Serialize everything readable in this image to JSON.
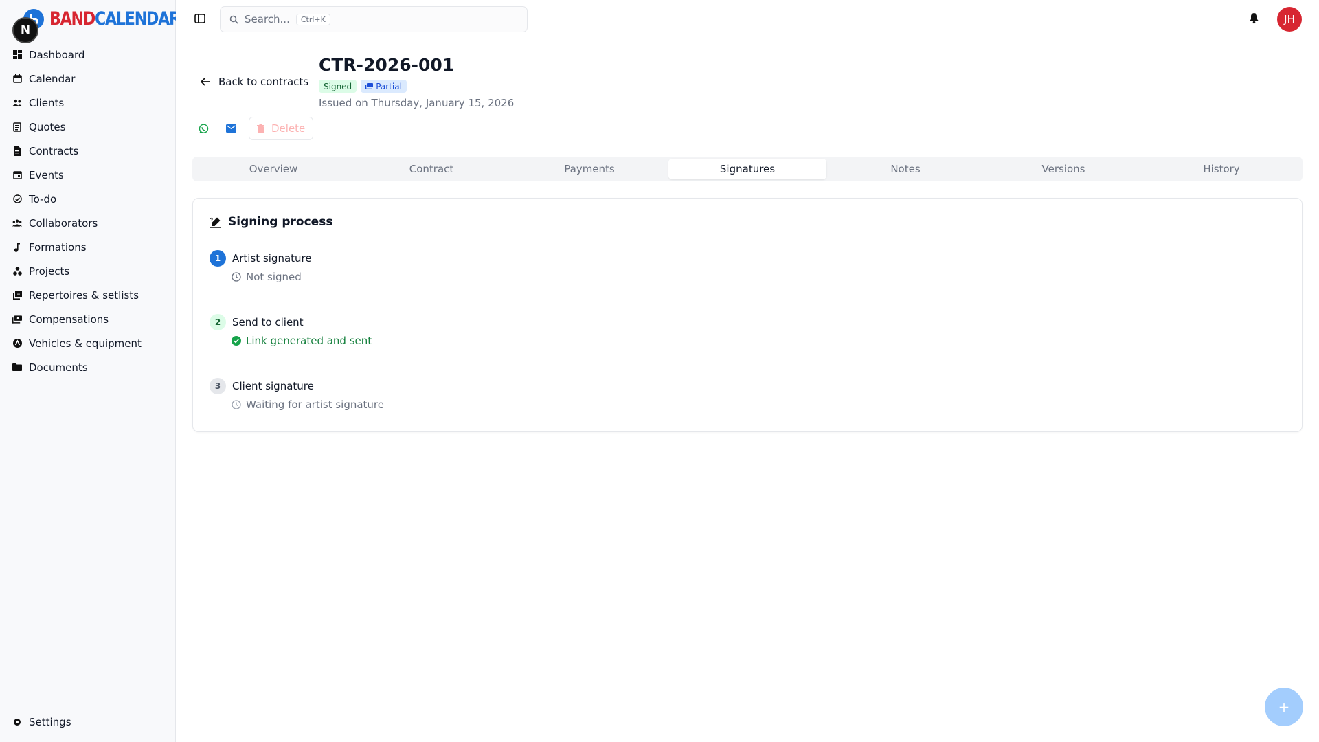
{
  "app": {
    "logo_part1": "BAND",
    "logo_part2": "CALENDAR"
  },
  "sidebar": {
    "items": [
      {
        "label": "Dashboard",
        "icon": "dashboard-icon"
      },
      {
        "label": "Calendar",
        "icon": "calendar-icon"
      },
      {
        "label": "Clients",
        "icon": "users-icon"
      },
      {
        "label": "Quotes",
        "icon": "quote-icon"
      },
      {
        "label": "Contracts",
        "icon": "contract-icon"
      },
      {
        "label": "Events",
        "icon": "event-icon"
      },
      {
        "label": "To-do",
        "icon": "todo-icon"
      },
      {
        "label": "Collaborators",
        "icon": "collaborators-icon"
      },
      {
        "label": "Formations",
        "icon": "music-note-icon"
      },
      {
        "label": "Projects",
        "icon": "projects-icon"
      },
      {
        "label": "Repertoires & setlists",
        "icon": "library-icon"
      },
      {
        "label": "Compensations",
        "icon": "payments-icon"
      },
      {
        "label": "Vehicles & equipment",
        "icon": "vehicle-icon"
      },
      {
        "label": "Documents",
        "icon": "folder-icon"
      }
    ],
    "settings_label": "Settings",
    "dev_badge": "N"
  },
  "topbar": {
    "search_placeholder": "Search...",
    "search_shortcut": "Ctrl+K",
    "avatar_initials": "JH"
  },
  "contract": {
    "back_label": "Back to contracts",
    "id": "CTR-2026-001",
    "badge_signed": "Signed",
    "badge_partial": "Partial",
    "issued": "Issued on Thursday, January 15, 2026",
    "delete_label": "Delete"
  },
  "tabs": [
    {
      "label": "Overview",
      "active": false
    },
    {
      "label": "Contract",
      "active": false
    },
    {
      "label": "Payments",
      "active": false
    },
    {
      "label": "Signatures",
      "active": true
    },
    {
      "label": "Notes",
      "active": false
    },
    {
      "label": "Versions",
      "active": false
    },
    {
      "label": "History",
      "active": false
    }
  ],
  "signing": {
    "title": "Signing process",
    "steps": [
      {
        "num": "1",
        "title": "Artist signature",
        "status": "Not signed",
        "state": "pending"
      },
      {
        "num": "2",
        "title": "Send to client",
        "status": "Link generated and sent",
        "state": "done"
      },
      {
        "num": "3",
        "title": "Client signature",
        "status": "Waiting for artist signature",
        "state": "waiting"
      }
    ]
  },
  "fab": {
    "label": "+"
  },
  "colors": {
    "brand_blue": "#1e73d8",
    "brand_red": "#d72631",
    "success": "#15803d",
    "muted": "#6b7280"
  }
}
